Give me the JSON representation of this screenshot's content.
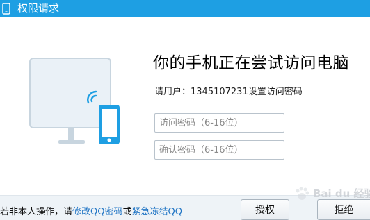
{
  "window": {
    "title": "权限请求",
    "title_icon": "phone-icon",
    "accent_color": "#1e9fe3"
  },
  "main": {
    "headline": "你的手机正在尝试访问电脑",
    "user_prefix": "请用户：",
    "user_id": "1345107231",
    "user_suffix": "设置访问密码",
    "password_placeholder": "访问密码（6-16位）",
    "confirm_placeholder": "确认密码（6-16位）",
    "password_value": "",
    "confirm_value": ""
  },
  "footer": {
    "text_prefix": "若非本人操作，请",
    "link_change_password": "修改QQ密码",
    "text_or": "或",
    "link_freeze": "紧急冻结QQ",
    "link_color": "#1f74c4",
    "authorize_label": "授权",
    "deny_label": "拒绝"
  },
  "watermark": {
    "text": "Bai du 经验",
    "icon": "paw-icon"
  }
}
